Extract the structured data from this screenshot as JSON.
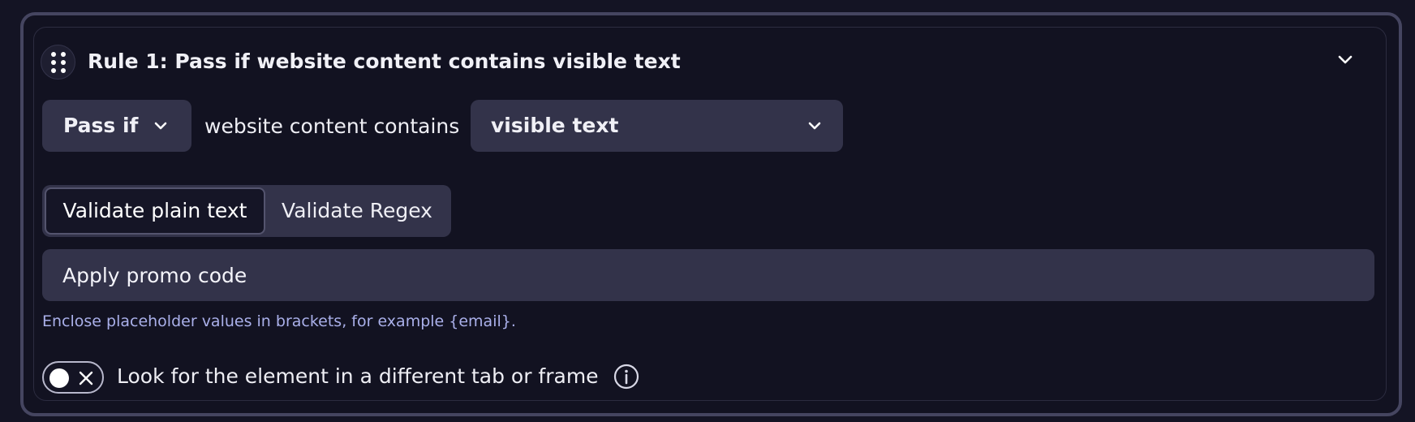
{
  "rule": {
    "title": "Rule 1: Pass if website content contains visible text"
  },
  "condition": {
    "operator": "Pass if",
    "middle_text": "website content contains",
    "content_type": "visible text"
  },
  "validation_mode": {
    "options": [
      "Validate plain text",
      "Validate Regex"
    ],
    "selected": "Validate plain text"
  },
  "text_input": {
    "value": "Apply promo code"
  },
  "hint": "Enclose placeholder values in brackets, for example {email}.",
  "toggle": {
    "label": "Look for the element in a different tab or frame",
    "enabled": false
  },
  "icons": {
    "drag": "drag-handle-icon",
    "collapse": "chevron-down-icon",
    "info": "info-icon"
  },
  "colors": {
    "background": "#141424",
    "card": "#121221",
    "control": "#33334a",
    "hint": "#aab0ea"
  }
}
